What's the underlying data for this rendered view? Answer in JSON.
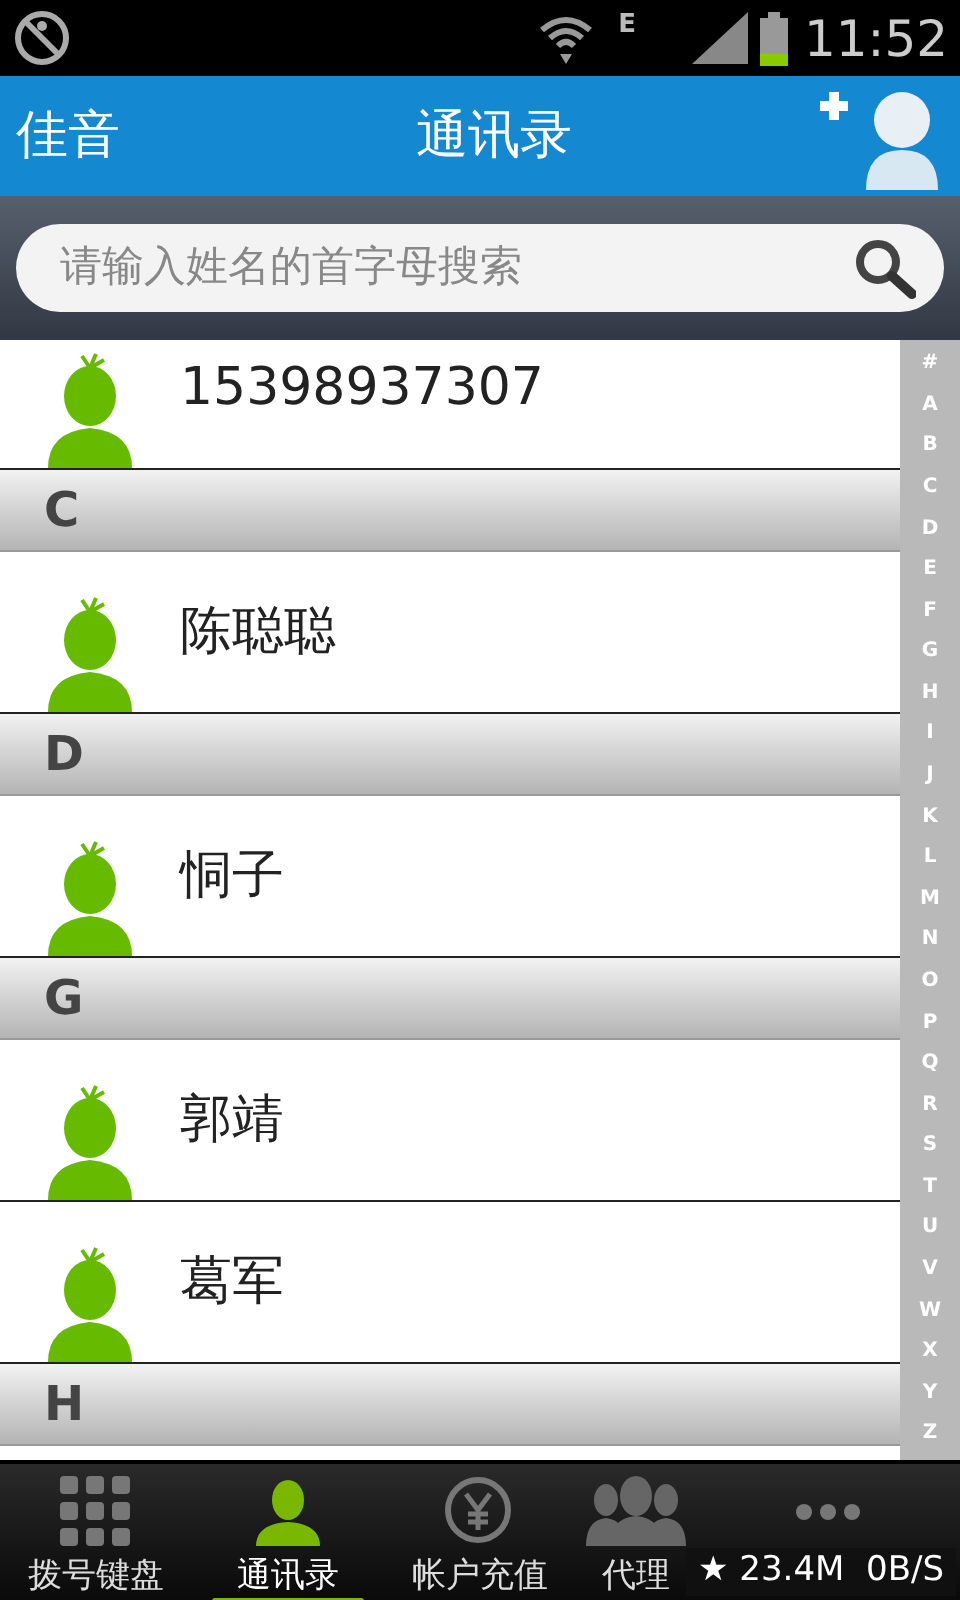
{
  "status_bar": {
    "network": "E",
    "time": "11:52"
  },
  "header": {
    "left": "佳音",
    "title": "通讯录"
  },
  "search": {
    "placeholder": "请输入姓名的首字母搜索"
  },
  "contacts": [
    {
      "kind": "contact",
      "name": "15398937307"
    },
    {
      "kind": "header",
      "name": "C"
    },
    {
      "kind": "contact",
      "name": "陈聪聪"
    },
    {
      "kind": "header",
      "name": "D"
    },
    {
      "kind": "contact",
      "name": "恫子"
    },
    {
      "kind": "header",
      "name": "G"
    },
    {
      "kind": "contact",
      "name": "郭靖"
    },
    {
      "kind": "contact",
      "name": "葛军"
    },
    {
      "kind": "header",
      "name": "H"
    }
  ],
  "index_letters": [
    "#",
    "A",
    "B",
    "C",
    "D",
    "E",
    "F",
    "G",
    "H",
    "I",
    "J",
    "K",
    "L",
    "M",
    "N",
    "O",
    "P",
    "Q",
    "R",
    "S",
    "T",
    "U",
    "V",
    "W",
    "X",
    "Y",
    "Z"
  ],
  "bottom_nav": [
    {
      "kind": "dialpad",
      "label": "拨号键盘",
      "selected": false
    },
    {
      "kind": "contacts",
      "label": "通讯录",
      "selected": true
    },
    {
      "kind": "recharge",
      "label": "帐户充值",
      "selected": false
    },
    {
      "kind": "agent",
      "label": "代理",
      "selected": false
    },
    {
      "kind": "more",
      "selected": false
    }
  ],
  "overlay": {
    "text": "★ 23.4M  0B/S"
  }
}
